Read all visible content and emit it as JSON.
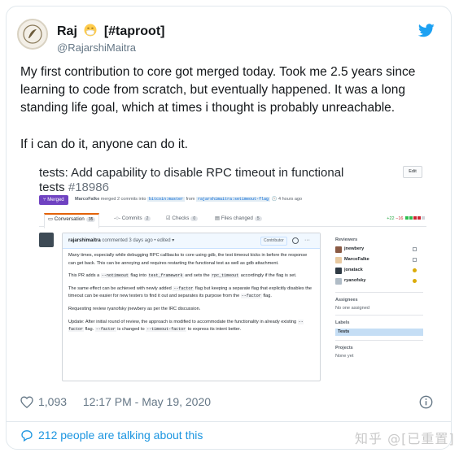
{
  "tweet": {
    "display_name": "Raj",
    "name_suffix": "[#taproot]",
    "handle": "@RajarshiMaitra",
    "paragraph_1": "My first contribution to core got merged today. Took me 2.5 years since learning to code from scratch, but eventually happened. It was a long standing life goal, which at times i thought is probably unreachable.",
    "paragraph_2": "If i can do it, anyone can do it.",
    "likes": "1,093",
    "timestamp": "12:17 PM - May 19, 2020",
    "talking": "212 people are talking about this"
  },
  "pr": {
    "title": "tests: Add capability to disable RPC timeout in functional tests",
    "number": "#18986",
    "edit_label": "Edit",
    "status": "Merged",
    "merger": "MarcoFalke",
    "merge_text": "merged 2 commits into",
    "base_branch": "bitcoin:master",
    "from_text": "from",
    "head_branch": "rajarshimaitra:setimeout-flag",
    "age": "4 hours ago",
    "tabs": {
      "conversation": "Conversation",
      "conversation_count": "35",
      "commits": "Commits",
      "commits_count": "2",
      "checks": "Checks",
      "checks_count": "0",
      "files": "Files changed",
      "files_count": "5"
    },
    "additions": "+22",
    "deletions": "−16",
    "comment": {
      "author": "rajarshimaitra",
      "meta": "commented 3 days ago • edited ▾",
      "badge": "Contributor",
      "p1": "Many times, especially while debugging RPC callbacks to core using gdb, the test timeout kicks in before the response can get back. This can be annoying and requires restarting the functional test as well as gdb attachment.",
      "p2_a": "This PR adds a",
      "p2_code1": "--notimeout",
      "p2_b": "flag into",
      "p2_code2": "test_framework",
      "p2_c": "and sets the",
      "p2_code3": "rpc_timeout",
      "p2_d": "accordingly if the flag is set.",
      "p3_a": "The same effect can be achieved with newly added",
      "p3_code1": "--factor",
      "p3_b": "flag but keeping a separate flag that explicitly disables the timeout can be easier for new testers to find it out and separates its purpose from the",
      "p3_code2": "--factor",
      "p3_c": "flag.",
      "p4": "Requesting review ryanofsky jnewbery as per the IRC discussion.",
      "p5_a": "Update: After initial round of review, the approach is modified to accommodate the functionality in already existing",
      "p5_code1": "--factor",
      "p5_b": "flag.",
      "p5_code2": "--factor",
      "p5_c": "is changed to",
      "p5_code3": "--timeout-factor",
      "p5_d": "to express its intent better."
    },
    "sidebar": {
      "reviewers_heading": "Reviewers",
      "reviewers": [
        "jnewbery",
        "MarcoFalke",
        "jonatack",
        "ryanofsky"
      ],
      "assignees_heading": "Assignees",
      "assignees_text": "No one assigned",
      "labels_heading": "Labels",
      "label": "Tests",
      "projects_heading": "Projects",
      "projects_text": "None yet"
    }
  },
  "watermark": "知乎 @[已重置]",
  "colors": {
    "brand": "#1da1f2",
    "merged": "#6f42c1",
    "link": "#1b95e0"
  }
}
